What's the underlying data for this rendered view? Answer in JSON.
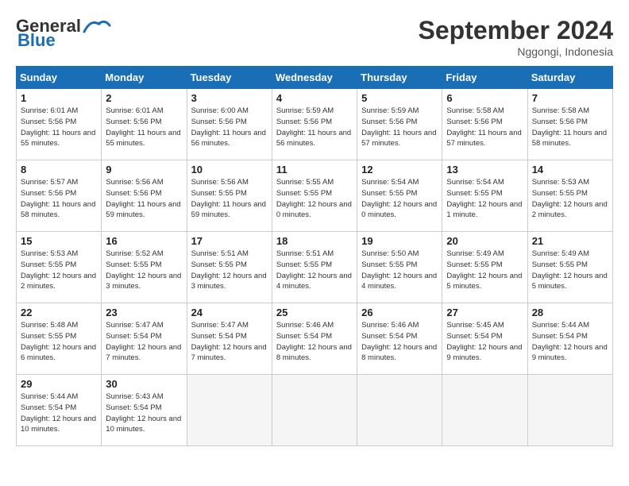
{
  "header": {
    "logo_line1": "General",
    "logo_line2": "Blue",
    "month": "September 2024",
    "location": "Nggongi, Indonesia"
  },
  "weekdays": [
    "Sunday",
    "Monday",
    "Tuesday",
    "Wednesday",
    "Thursday",
    "Friday",
    "Saturday"
  ],
  "weeks": [
    [
      {
        "day": "1",
        "sunrise": "6:01 AM",
        "sunset": "5:56 PM",
        "daylight": "11 hours and 55 minutes."
      },
      {
        "day": "2",
        "sunrise": "6:01 AM",
        "sunset": "5:56 PM",
        "daylight": "11 hours and 55 minutes."
      },
      {
        "day": "3",
        "sunrise": "6:00 AM",
        "sunset": "5:56 PM",
        "daylight": "11 hours and 56 minutes."
      },
      {
        "day": "4",
        "sunrise": "5:59 AM",
        "sunset": "5:56 PM",
        "daylight": "11 hours and 56 minutes."
      },
      {
        "day": "5",
        "sunrise": "5:59 AM",
        "sunset": "5:56 PM",
        "daylight": "11 hours and 57 minutes."
      },
      {
        "day": "6",
        "sunrise": "5:58 AM",
        "sunset": "5:56 PM",
        "daylight": "11 hours and 57 minutes."
      },
      {
        "day": "7",
        "sunrise": "5:58 AM",
        "sunset": "5:56 PM",
        "daylight": "11 hours and 58 minutes."
      }
    ],
    [
      {
        "day": "8",
        "sunrise": "5:57 AM",
        "sunset": "5:56 PM",
        "daylight": "11 hours and 58 minutes."
      },
      {
        "day": "9",
        "sunrise": "5:56 AM",
        "sunset": "5:56 PM",
        "daylight": "11 hours and 59 minutes."
      },
      {
        "day": "10",
        "sunrise": "5:56 AM",
        "sunset": "5:55 PM",
        "daylight": "11 hours and 59 minutes."
      },
      {
        "day": "11",
        "sunrise": "5:55 AM",
        "sunset": "5:55 PM",
        "daylight": "12 hours and 0 minutes."
      },
      {
        "day": "12",
        "sunrise": "5:54 AM",
        "sunset": "5:55 PM",
        "daylight": "12 hours and 0 minutes."
      },
      {
        "day": "13",
        "sunrise": "5:54 AM",
        "sunset": "5:55 PM",
        "daylight": "12 hours and 1 minute."
      },
      {
        "day": "14",
        "sunrise": "5:53 AM",
        "sunset": "5:55 PM",
        "daylight": "12 hours and 2 minutes."
      }
    ],
    [
      {
        "day": "15",
        "sunrise": "5:53 AM",
        "sunset": "5:55 PM",
        "daylight": "12 hours and 2 minutes."
      },
      {
        "day": "16",
        "sunrise": "5:52 AM",
        "sunset": "5:55 PM",
        "daylight": "12 hours and 3 minutes."
      },
      {
        "day": "17",
        "sunrise": "5:51 AM",
        "sunset": "5:55 PM",
        "daylight": "12 hours and 3 minutes."
      },
      {
        "day": "18",
        "sunrise": "5:51 AM",
        "sunset": "5:55 PM",
        "daylight": "12 hours and 4 minutes."
      },
      {
        "day": "19",
        "sunrise": "5:50 AM",
        "sunset": "5:55 PM",
        "daylight": "12 hours and 4 minutes."
      },
      {
        "day": "20",
        "sunrise": "5:49 AM",
        "sunset": "5:55 PM",
        "daylight": "12 hours and 5 minutes."
      },
      {
        "day": "21",
        "sunrise": "5:49 AM",
        "sunset": "5:55 PM",
        "daylight": "12 hours and 5 minutes."
      }
    ],
    [
      {
        "day": "22",
        "sunrise": "5:48 AM",
        "sunset": "5:55 PM",
        "daylight": "12 hours and 6 minutes."
      },
      {
        "day": "23",
        "sunrise": "5:47 AM",
        "sunset": "5:54 PM",
        "daylight": "12 hours and 7 minutes."
      },
      {
        "day": "24",
        "sunrise": "5:47 AM",
        "sunset": "5:54 PM",
        "daylight": "12 hours and 7 minutes."
      },
      {
        "day": "25",
        "sunrise": "5:46 AM",
        "sunset": "5:54 PM",
        "daylight": "12 hours and 8 minutes."
      },
      {
        "day": "26",
        "sunrise": "5:46 AM",
        "sunset": "5:54 PM",
        "daylight": "12 hours and 8 minutes."
      },
      {
        "day": "27",
        "sunrise": "5:45 AM",
        "sunset": "5:54 PM",
        "daylight": "12 hours and 9 minutes."
      },
      {
        "day": "28",
        "sunrise": "5:44 AM",
        "sunset": "5:54 PM",
        "daylight": "12 hours and 9 minutes."
      }
    ],
    [
      {
        "day": "29",
        "sunrise": "5:44 AM",
        "sunset": "5:54 PM",
        "daylight": "12 hours and 10 minutes."
      },
      {
        "day": "30",
        "sunrise": "5:43 AM",
        "sunset": "5:54 PM",
        "daylight": "12 hours and 10 minutes."
      },
      null,
      null,
      null,
      null,
      null
    ]
  ]
}
